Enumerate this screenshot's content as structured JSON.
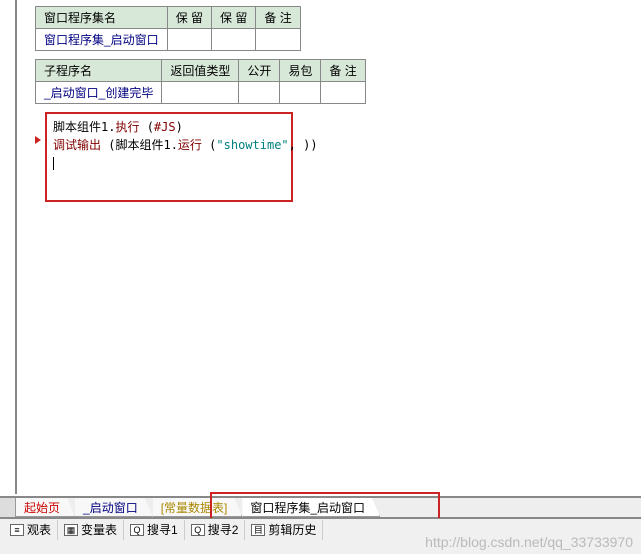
{
  "table1": {
    "headers": [
      "窗口程序集名",
      "保  留",
      "保  留",
      "备 注"
    ],
    "row": [
      "窗口程序集_启动窗口",
      "",
      "",
      ""
    ]
  },
  "table2": {
    "headers": [
      "子程序名",
      "返回值类型",
      "公开",
      "易包",
      "备  注"
    ],
    "row": [
      "_启动窗口_创建完毕",
      "",
      "",
      "",
      ""
    ]
  },
  "code": {
    "l1a": "脚本组件1.",
    "l1b": "执行",
    "l1c": " (",
    "l1d": "#JS",
    "l1e": ")",
    "l2a": "调试输出",
    "l2b": " (脚本组件1.",
    "l2c": "运行",
    "l2d": " (",
    "l2e": "\"showtime\"",
    "l2f": ", ))"
  },
  "tabs": {
    "start": "起始页",
    "win": "_启动窗口",
    "const": "[常量数据表]",
    "procset": "窗口程序集_启动窗口"
  },
  "status": {
    "watch": "观表",
    "vartable": "变量表",
    "search1": "搜寻1",
    "search2": "搜寻2",
    "cliphist": "剪辑历史"
  },
  "watermark": "http://blog.csdn.net/qq_33733970"
}
